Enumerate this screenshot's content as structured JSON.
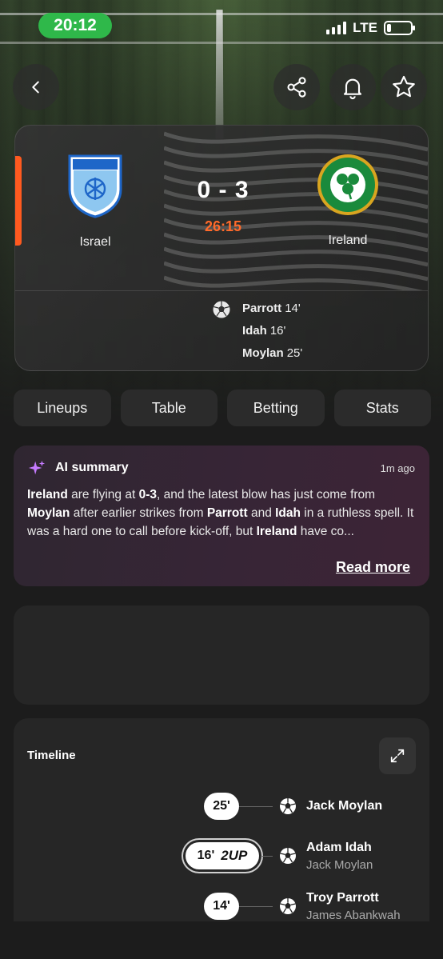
{
  "status_bar": {
    "time": "20:12",
    "network": "LTE"
  },
  "nav": {
    "back_icon": "chevron-left-icon",
    "share_icon": "share-icon",
    "bell_icon": "bell-icon",
    "star_icon": "star-icon"
  },
  "match": {
    "home_team": "Israel",
    "away_team": "Ireland",
    "score": "0 - 3",
    "clock": "26:15",
    "scorers": [
      {
        "name": "Parrott",
        "minute": "14'"
      },
      {
        "name": "Idah",
        "minute": "16'"
      },
      {
        "name": "Moylan",
        "minute": "25'"
      }
    ]
  },
  "tabs": [
    "Lineups",
    "Table",
    "Betting",
    "Stats"
  ],
  "ai_summary": {
    "title": "AI summary",
    "time": "1m ago",
    "body_parts": [
      {
        "text": "Ireland",
        "bold": true
      },
      {
        "text": " are flying at ",
        "bold": false
      },
      {
        "text": "0-3",
        "bold": true
      },
      {
        "text": ", and the latest blow has just come from ",
        "bold": false
      },
      {
        "text": "Moylan",
        "bold": true
      },
      {
        "text": " after earlier strikes from ",
        "bold": false
      },
      {
        "text": "Parrott",
        "bold": true
      },
      {
        "text": " and ",
        "bold": false
      },
      {
        "text": "Idah",
        "bold": true
      },
      {
        "text": " in a ruthless spell. It was a hard one to call before kick-off, but ",
        "bold": false
      },
      {
        "text": "Ireland",
        "bold": true
      },
      {
        "text": " have co...",
        "bold": false
      }
    ],
    "read_more": "Read more"
  },
  "timeline": {
    "title": "Timeline",
    "events": [
      {
        "minute": "25'",
        "badge": "",
        "player": "Jack Moylan",
        "assist": ""
      },
      {
        "minute": "16'",
        "badge": "2UP",
        "player": "Adam Idah",
        "assist": "Jack Moylan"
      },
      {
        "minute": "14'",
        "badge": "",
        "player": "Troy Parrott",
        "assist": "James Abankwah"
      }
    ]
  },
  "colors": {
    "accent": "#ff5a1f",
    "status_green": "#2fb84a",
    "ai_sparkle": "#c57bff"
  }
}
